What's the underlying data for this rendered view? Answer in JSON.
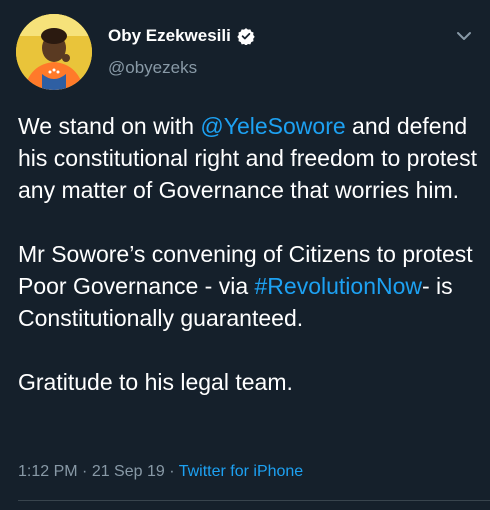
{
  "author": {
    "display_name": "Oby Ezekwesili",
    "handle": "@obyezeks",
    "verified": true,
    "avatar_icon": "profile-photo",
    "verified_icon": "verified-badge-icon"
  },
  "menu_icon": "chevron-down-icon",
  "tweet": {
    "para1": {
      "pre": "We stand on with ",
      "mention": "@YeleSowore",
      "post1": " and defend his constitutional right and freedom to protest any matter of Governance that worries him."
    },
    "para2": {
      "pre": "Mr Sowore’s convening of Citizens to protest Poor Governance - via ",
      "hashtag": "#RevolutionNow",
      "post": "- is Constitutionally guaranteed."
    },
    "para3": "Gratitude to his legal team."
  },
  "meta": {
    "time": "1:12 PM",
    "sep1": " · ",
    "date": "21 Sep 19",
    "sep2": " · ",
    "source": "Twitter for iPhone"
  },
  "colors": {
    "background": "#15202b",
    "link": "#1da1f2",
    "secondary_text": "#8899a6"
  }
}
